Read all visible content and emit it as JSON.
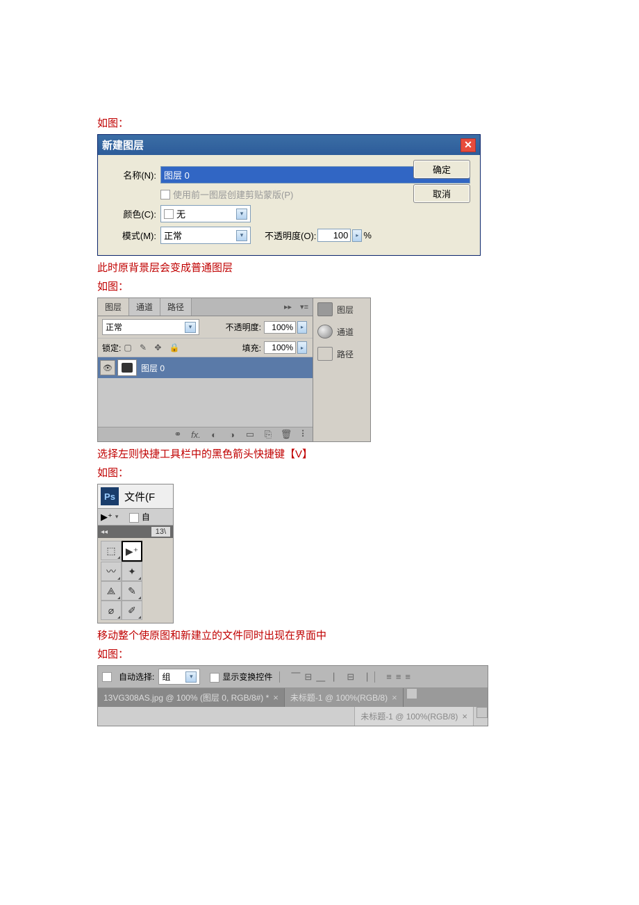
{
  "text": {
    "intro": "如图：",
    "after_dialog": "此时原背景层会变成普通图层",
    "intro2": "如图：",
    "after_layers": "选择左则快捷工具栏中的黑色箭头快捷键【V】",
    "intro3": "如图：",
    "after_toolbar": "移动整个使原图和新建立的文件同时出现在界面中",
    "intro4": "如图："
  },
  "dialog": {
    "title": "新建图层",
    "name_label": "名称(N):",
    "name_value": "图层 0",
    "clip_label": "使用前一图层创建剪贴蒙版(P)",
    "color_label": "颜色(C):",
    "color_value": "无",
    "mode_label": "模式(M):",
    "mode_value": "正常",
    "opacity_label": "不透明度(O):",
    "opacity_value": "100",
    "opacity_unit": "%",
    "ok": "确定",
    "cancel": "取消"
  },
  "layers": {
    "tab1": "图层",
    "tab2": "通道",
    "tab3": "路径",
    "mode": "正常",
    "opac_label": "不透明度:",
    "opac_value": "100%",
    "lock_label": "锁定:",
    "fill_label": "填充:",
    "fill_value": "100%",
    "layer_name": "图层 0",
    "fx": "fx.",
    "side_layers": "图层",
    "side_channels": "通道",
    "side_paths": "路径"
  },
  "toolbar": {
    "ps": "Ps",
    "file": "文件(F",
    "auto": "自",
    "zoom": "13\\"
  },
  "optbar": {
    "auto_select": "自动选择:",
    "group": "组",
    "show_transform": "显示变换控件",
    "tab1": "13VG308AS.jpg @ 100% (图层 0, RGB/8#) *",
    "tab2": "未标题-1 @ 100%(RGB/8)",
    "tab3": "未标题-1 @ 100%(RGB/8)"
  }
}
